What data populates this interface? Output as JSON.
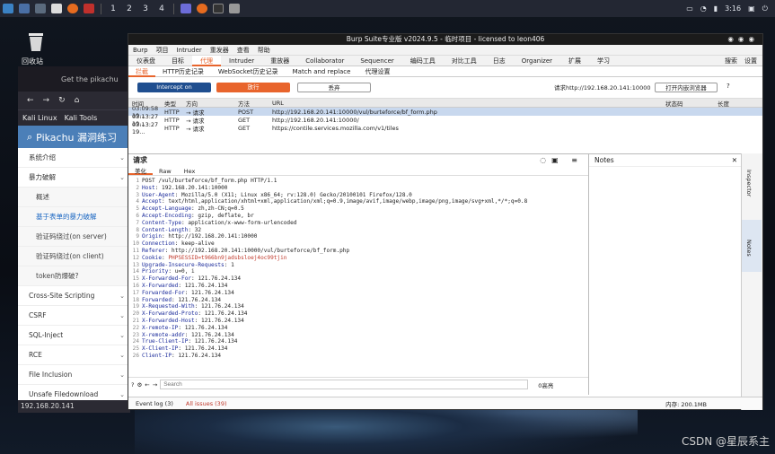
{
  "taskbar": {
    "workspaces": [
      "1",
      "2",
      "3",
      "4"
    ],
    "clock": "3:16"
  },
  "desktop": {
    "trash_label": "回收站"
  },
  "firefox": {
    "tab_title": "Get the pikachu",
    "bookmarks": [
      "Kali Linux",
      "Kali Tools"
    ],
    "page_title": "Pikachu 漏洞练习",
    "sidebar": [
      {
        "label": "系统介绍",
        "type": "top"
      },
      {
        "label": "暴力破解",
        "type": "top"
      },
      {
        "label": "概述",
        "type": "sub"
      },
      {
        "label": "基于表单的暴力破解",
        "type": "sub",
        "active": true
      },
      {
        "label": "验证码绕过(on server)",
        "type": "sub"
      },
      {
        "label": "验证码绕过(on client)",
        "type": "sub"
      },
      {
        "label": "token防爆破?",
        "type": "sub"
      },
      {
        "label": "Cross-Site Scripting",
        "type": "top"
      },
      {
        "label": "CSRF",
        "type": "top"
      },
      {
        "label": "SQL-Inject",
        "type": "top"
      },
      {
        "label": "RCE",
        "type": "top"
      },
      {
        "label": "File Inclusion",
        "type": "top"
      },
      {
        "label": "Unsafe Filedownload",
        "type": "top"
      }
    ],
    "status": "192.168.20.141"
  },
  "burp": {
    "title": "Burp Suite专业版  v2024.9.5 - 临时项目 - licensed to leon406",
    "menu": [
      "Burp",
      "项目",
      "Intruder",
      "重发器",
      "查看",
      "帮助"
    ],
    "tabs": [
      "仪表盘",
      "目标",
      "代理",
      "Intruder",
      "重放器",
      "Collaborator",
      "Sequencer",
      "编码工具",
      "对比工具",
      "日志",
      "Organizer",
      "扩展",
      "学习"
    ],
    "active_tab": "代理",
    "search_label": "搜索",
    "settings_label": "设置",
    "subtabs": [
      "拦截",
      "HTTP历史记录",
      "WebSocket历史记录",
      "Match and replace",
      "代理设置"
    ],
    "intercept_label": "Intercept on",
    "forward_label": "放行",
    "drop_label": "丢弃",
    "request_to": "请求http://192.168.20.141:10000",
    "open_browser": "打开内嵌浏览器",
    "table_headers": [
      "时间",
      "类型",
      "方向",
      "方法",
      "URL",
      "状态码",
      "长度"
    ],
    "rows": [
      {
        "time": "03:09:58 19...",
        "type": "HTTP",
        "dir": "→ 请求",
        "method": "POST",
        "url": "http://192.168.20.141:10000/vul/burteforce/bf_form.php",
        "selected": true
      },
      {
        "time": "03:13:27 19...",
        "type": "HTTP",
        "dir": "→ 请求",
        "method": "GET",
        "url": "http://192.168.20.141:10000/",
        "selected": false
      },
      {
        "time": "03:13:27 19...",
        "type": "HTTP",
        "dir": "→ 请求",
        "method": "GET",
        "url": "https://contile.services.mozilla.com/v1/tiles",
        "selected": false
      }
    ],
    "editor_title": "请求",
    "editor_tabs": [
      "美化",
      "Raw",
      "Hex"
    ],
    "code_lines": [
      [
        "",
        "POST /vul/burteforce/bf_form.php HTTP/1.1"
      ],
      [
        "Host",
        "192.168.20.141:10000"
      ],
      [
        "User-Agent",
        "Mozilla/5.0 (X11; Linux x86_64; rv:128.0) Gecko/20100101 Firefox/128.0"
      ],
      [
        "Accept",
        "text/html,application/xhtml+xml,application/xml;q=0.9,image/avif,image/webp,image/png,image/svg+xml,*/*;q=0.8"
      ],
      [
        "Accept-Language",
        "zh,zh-CN;q=0.5"
      ],
      [
        "Accept-Encoding",
        "gzip, deflate, br"
      ],
      [
        "Content-Type",
        "application/x-www-form-urlencoded"
      ],
      [
        "Content-Length",
        "32"
      ],
      [
        "Origin",
        "http://192.168.20.141:10000"
      ],
      [
        "Connection",
        "keep-alive"
      ],
      [
        "Referer",
        "http://192.168.20.141:10000/vul/burteforce/bf_form.php"
      ],
      [
        "Cookie",
        "PHPSESSID=t966bn9jadsbsloej4oc99tjin"
      ],
      [
        "Upgrade-Insecure-Requests",
        "1"
      ],
      [
        "Priority",
        "u=0, i"
      ],
      [
        "X-Forwarded-For",
        "121.76.24.134"
      ],
      [
        "X-Forwarded",
        "121.76.24.134"
      ],
      [
        "Forwarded-For",
        "121.76.24.134"
      ],
      [
        "Forwarded",
        "121.76.24.134"
      ],
      [
        "X-Requested-With",
        "121.76.24.134"
      ],
      [
        "X-Forwarded-Proto",
        "121.76.24.134"
      ],
      [
        "X-Forwarded-Host",
        "121.76.24.134"
      ],
      [
        "X-remote-IP",
        "121.76.24.134"
      ],
      [
        "X-remote-addr",
        "121.76.24.134"
      ],
      [
        "True-Client-IP",
        "121.76.24.134"
      ],
      [
        "X-Client-IP",
        "121.76.24.134"
      ],
      [
        "Client-IP",
        "121.76.24.134"
      ]
    ],
    "search_placeholder": "Search",
    "matches": "0高亮",
    "notes_title": "Notes",
    "side_tabs": [
      "Inspector",
      "Notes"
    ],
    "status_tabs": [
      "Event log (3)",
      "All issues (39)"
    ],
    "memory": "内存: 200.1MB"
  },
  "watermark": "CSDN @星辰系主"
}
